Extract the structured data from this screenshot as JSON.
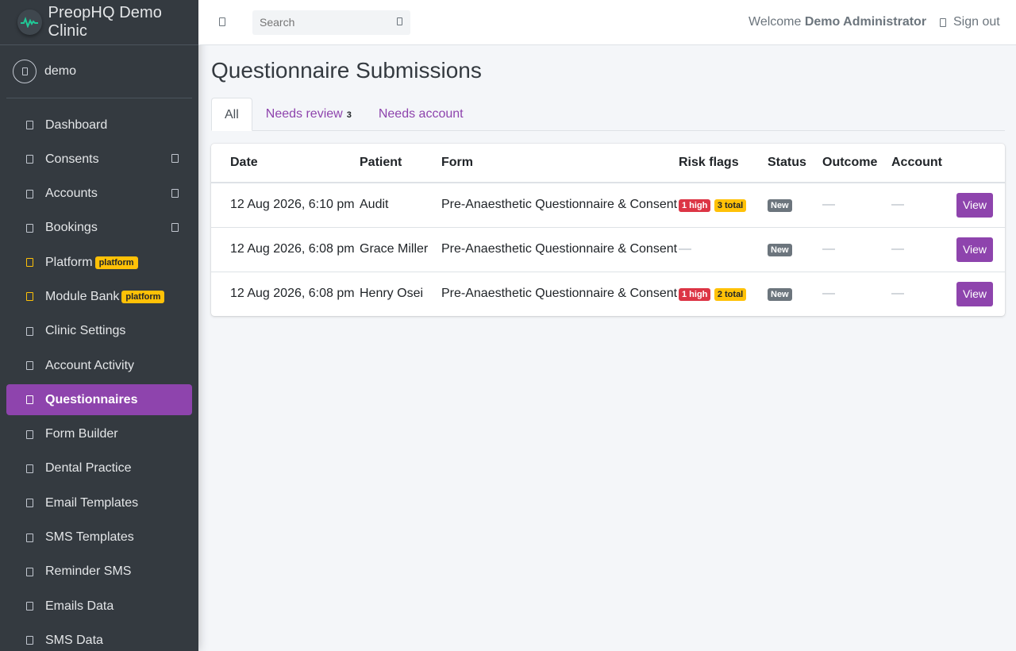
{
  "brand": {
    "name": "PreopHQ Demo Clinic"
  },
  "user": {
    "name": "demo"
  },
  "nav": {
    "items": [
      {
        "label": "Dashboard"
      },
      {
        "label": "Consents"
      },
      {
        "label": "Accounts"
      },
      {
        "label": "Bookings"
      },
      {
        "label": "Platform",
        "badge": "platform"
      },
      {
        "label": "Module Bank",
        "badge": "platform"
      },
      {
        "label": "Clinic Settings"
      },
      {
        "label": "Account Activity"
      },
      {
        "label": "Questionnaires"
      },
      {
        "label": "Form Builder"
      },
      {
        "label": "Dental Practice"
      },
      {
        "label": "Email Templates"
      },
      {
        "label": "SMS Templates"
      },
      {
        "label": "Reminder SMS"
      },
      {
        "label": "Emails Data"
      },
      {
        "label": "SMS Data"
      }
    ]
  },
  "header": {
    "search_placeholder": "Search",
    "welcome_prefix": "Welcome",
    "welcome_user": "Demo Administrator",
    "sign_out": "Sign out"
  },
  "page": {
    "title": "Questionnaire Submissions",
    "tabs": [
      {
        "label": "All"
      },
      {
        "label": "Needs review",
        "count": "3"
      },
      {
        "label": "Needs account"
      }
    ]
  },
  "table": {
    "headers": [
      "Date",
      "Patient",
      "Form",
      "Risk flags",
      "Status",
      "Outcome",
      "Account"
    ],
    "rows": [
      {
        "date": "12 Aug 2026, 6:10 pm",
        "patient": "Audit",
        "form": "Pre-Anaesthetic Questionnaire & Consent",
        "high": "1 high",
        "total": "3 total",
        "status": "New",
        "outcome": "—",
        "account": "—",
        "action": "View"
      },
      {
        "date": "12 Aug 2026, 6:08 pm",
        "patient": "Grace Miller",
        "form": "Pre-Anaesthetic Questionnaire & Consent",
        "risk": "—",
        "status": "New",
        "outcome": "—",
        "account": "—",
        "action": "View"
      },
      {
        "date": "12 Aug 2026, 6:08 pm",
        "patient": "Henry Osei",
        "form": "Pre-Anaesthetic Questionnaire & Consent",
        "high": "1 high",
        "total": "2 total",
        "status": "New",
        "outcome": "—",
        "account": "—",
        "action": "View"
      }
    ]
  },
  "colors": {
    "accent": "#8e44ad",
    "sidebar": "#343a40",
    "danger": "#dc3545",
    "warning": "#ffc107",
    "secondary": "#6c757d"
  }
}
